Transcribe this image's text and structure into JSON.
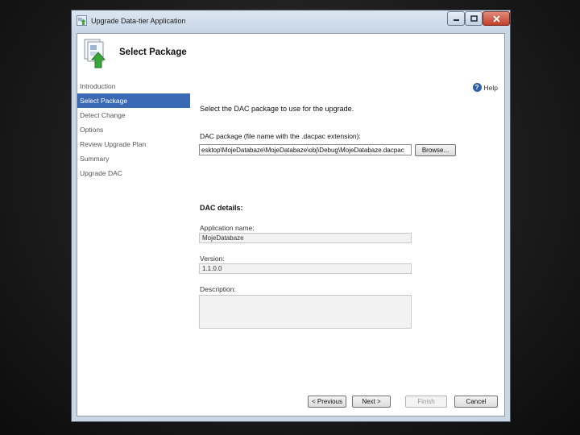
{
  "window": {
    "title": "Upgrade Data-tier Application"
  },
  "header": {
    "title": "Select Package"
  },
  "sidebar": {
    "items": [
      {
        "label": "Introduction",
        "active": false
      },
      {
        "label": "Select Package",
        "active": true
      },
      {
        "label": "Detect Change",
        "active": false
      },
      {
        "label": "Options",
        "active": false
      },
      {
        "label": "Review Upgrade Plan",
        "active": false
      },
      {
        "label": "Summary",
        "active": false
      },
      {
        "label": "Upgrade DAC",
        "active": false
      }
    ]
  },
  "content": {
    "help_label": "Help",
    "instruction": "Select the DAC package to use for the upgrade.",
    "package_label": "DAC package (file name with the .dacpac extension):",
    "package_value": "esktop\\MojeDatabaze\\MojeDatabaze\\obj\\Debug\\MojeDatabaze.dacpac",
    "browse_label": "Browse...",
    "details_title": "DAC details:",
    "app_name_label": "Application name:",
    "app_name_value": "MojeDatabaze",
    "version_label": "Version:",
    "version_value": "1.1.0.0",
    "description_label": "Description:"
  },
  "footer": {
    "previous_label": "< Previous",
    "next_label": "Next >",
    "finish_label": "Finish",
    "cancel_label": "Cancel"
  },
  "colors": {
    "selection": "#3a69b6",
    "window_frame": "#c9d6e3"
  }
}
